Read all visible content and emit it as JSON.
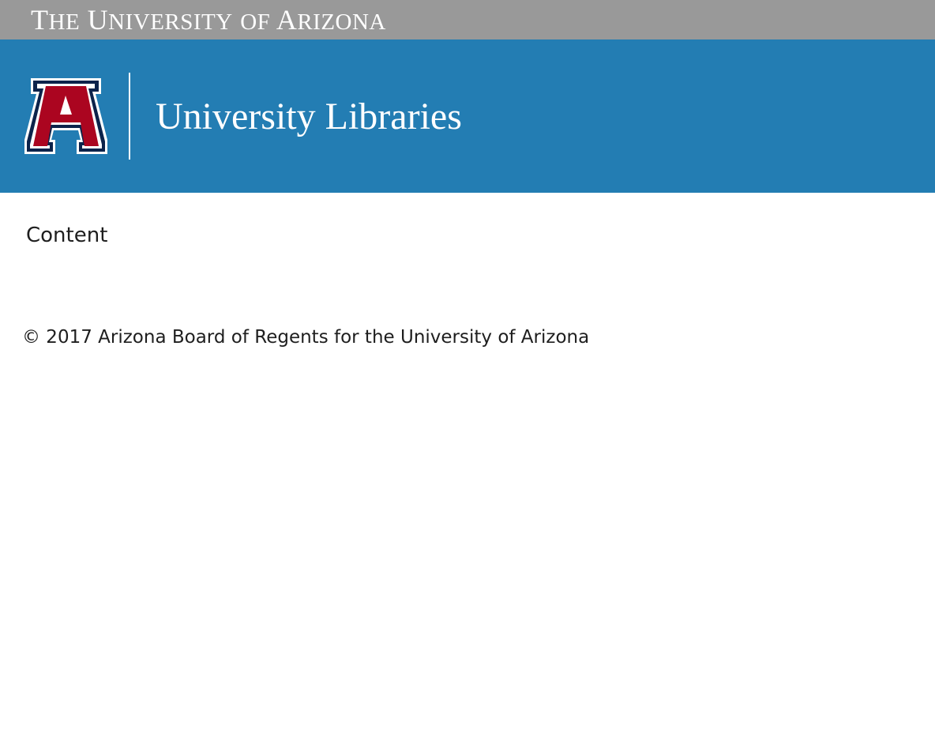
{
  "header": {
    "university_first": "T",
    "university_small_1": "HE",
    "university_first_2": "U",
    "university_small_2": "NIVERSITY",
    "university_small_3": "OF",
    "university_first_3": "A",
    "university_small_4": "RIZONA",
    "logo_icon": "arizona-block-a-logo",
    "library_title": "University Libraries"
  },
  "main": {
    "content_label": "Content"
  },
  "footer": {
    "copyright": "© 2017 Arizona Board of Regents for the University of Arizona"
  },
  "colors": {
    "topbar": "#999999",
    "banner": "#237db3",
    "logo_navy": "#0c234b",
    "logo_red": "#ab0520"
  }
}
